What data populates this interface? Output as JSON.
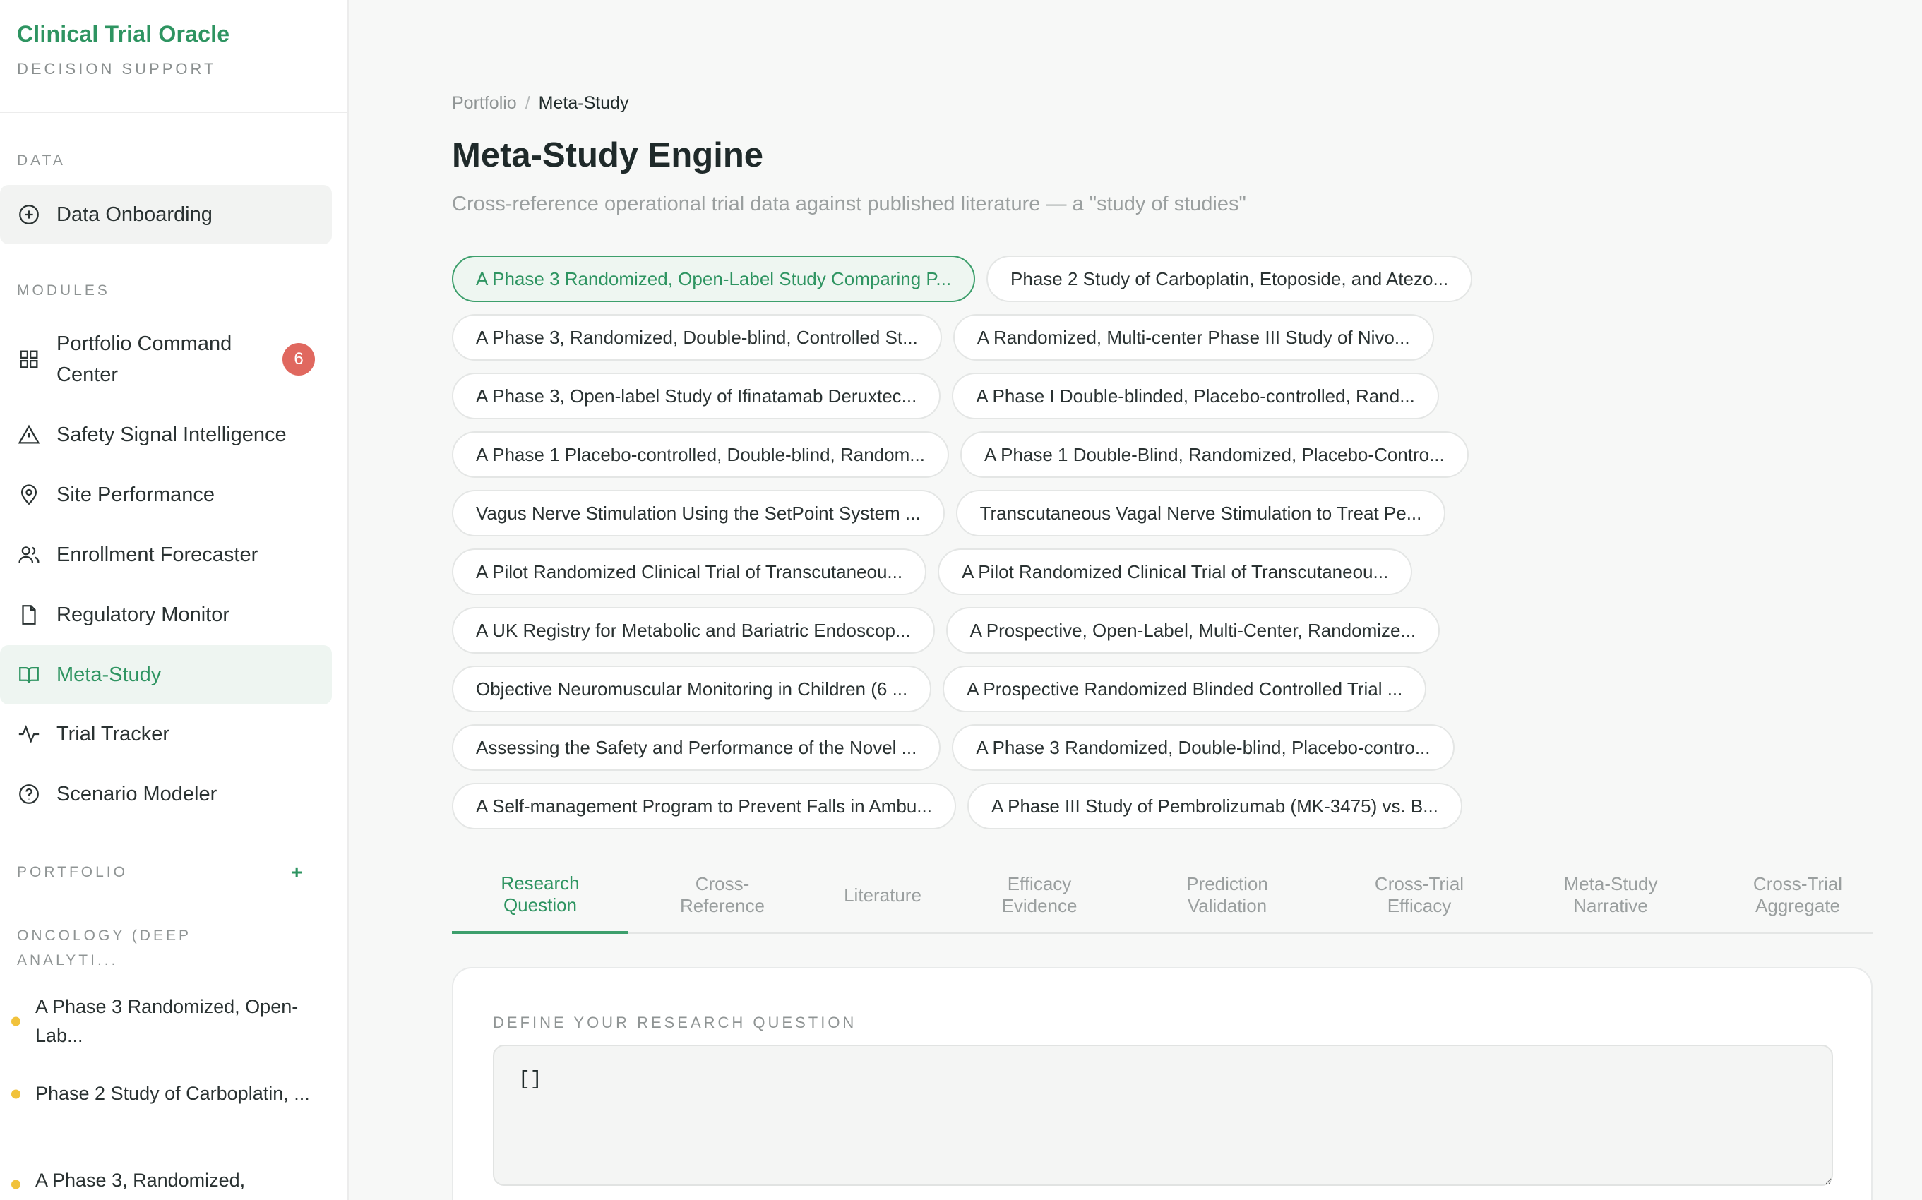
{
  "brand": {
    "title": "Clinical Trial Oracle",
    "subtitle": "DECISION SUPPORT"
  },
  "sidebar": {
    "data_label": "DATA",
    "data_item": {
      "label": "Data Onboarding",
      "icon": "plus-circle-icon"
    },
    "modules_label": "MODULES",
    "modules": [
      {
        "label": "Portfolio Command Center",
        "icon": "grid-icon",
        "badge": "6"
      },
      {
        "label": "Safety Signal Intelligence",
        "icon": "warning-triangle-icon"
      },
      {
        "label": "Site Performance",
        "icon": "map-pin-icon"
      },
      {
        "label": "Enrollment Forecaster",
        "icon": "users-icon"
      },
      {
        "label": "Regulatory Monitor",
        "icon": "document-icon"
      },
      {
        "label": "Meta-Study",
        "icon": "book-open-icon",
        "active": true
      },
      {
        "label": "Trial Tracker",
        "icon": "activity-icon"
      },
      {
        "label": "Scenario Modeler",
        "icon": "help-circle-icon"
      }
    ],
    "portfolio_label": "PORTFOLIO",
    "portfolio_add": "+",
    "group_label": "ONCOLOGY (DEEP ANALYTI...",
    "trials": [
      "A Phase 3 Randomized, Open-Lab...",
      "Phase 2 Study of Carboplatin, ...",
      "A Phase 3, Randomized,"
    ]
  },
  "breadcrumb": {
    "parent": "Portfolio",
    "separator": "/",
    "current": "Meta-Study"
  },
  "page": {
    "title": "Meta-Study Engine",
    "subtitle": "Cross-reference operational trial data against published literature — a \"study of studies\""
  },
  "studies": [
    [
      "A Phase 3 Randomized, Open-Label Study Comparing P...",
      "Phase 2 Study of Carboplatin, Etoposide, and Atezo..."
    ],
    [
      "A Phase 3, Randomized, Double-blind, Controlled St...",
      "A Randomized, Multi-center Phase III Study of Nivo..."
    ],
    [
      "A Phase 3, Open-label Study of Ifinatamab Deruxtec...",
      "A Phase I Double-blinded, Placebo-controlled, Rand..."
    ],
    [
      "A Phase 1 Placebo-controlled, Double-blind, Random...",
      "A Phase 1 Double-Blind, Randomized, Placebo-Contro..."
    ],
    [
      "Vagus Nerve Stimulation Using the SetPoint System ...",
      "Transcutaneous Vagal Nerve Stimulation to Treat Pe..."
    ],
    [
      "A Pilot Randomized Clinical Trial of Transcutaneou...",
      "A Pilot Randomized Clinical Trial of Transcutaneou..."
    ],
    [
      "A UK Registry for Metabolic and Bariatric Endoscop...",
      "A Prospective, Open-Label, Multi-Center, Randomize..."
    ],
    [
      "Objective Neuromuscular Monitoring in Children (6 ...",
      "A Prospective Randomized Blinded Controlled Trial ..."
    ],
    [
      "Assessing the Safety and Performance of the Novel ...",
      "A Phase 3 Randomized, Double-blind, Placebo-contro..."
    ],
    [
      "A Self-management Program to Prevent Falls in Ambu...",
      "A Phase III Study of Pembrolizumab (MK-3475) vs. B..."
    ]
  ],
  "tabs": [
    {
      "line1": "Research",
      "line2": "Question",
      "active": true
    },
    {
      "line1": "Cross-",
      "line2": "Reference"
    },
    {
      "line1": "Literature",
      "line2": ""
    },
    {
      "line1": "Efficacy",
      "line2": "Evidence"
    },
    {
      "line1": "Prediction",
      "line2": "Validation"
    },
    {
      "line1": "Cross-Trial",
      "line2": "Efficacy"
    },
    {
      "line1": "Meta-Study",
      "line2": "Narrative"
    },
    {
      "line1": "Cross-Trial",
      "line2": "Aggregate"
    }
  ],
  "research": {
    "label": "DEFINE YOUR RESEARCH QUESTION",
    "value": "[]"
  },
  "colors": {
    "accent": "#2e9461",
    "badge": "#e0685f",
    "dot": "#f1c23b"
  }
}
